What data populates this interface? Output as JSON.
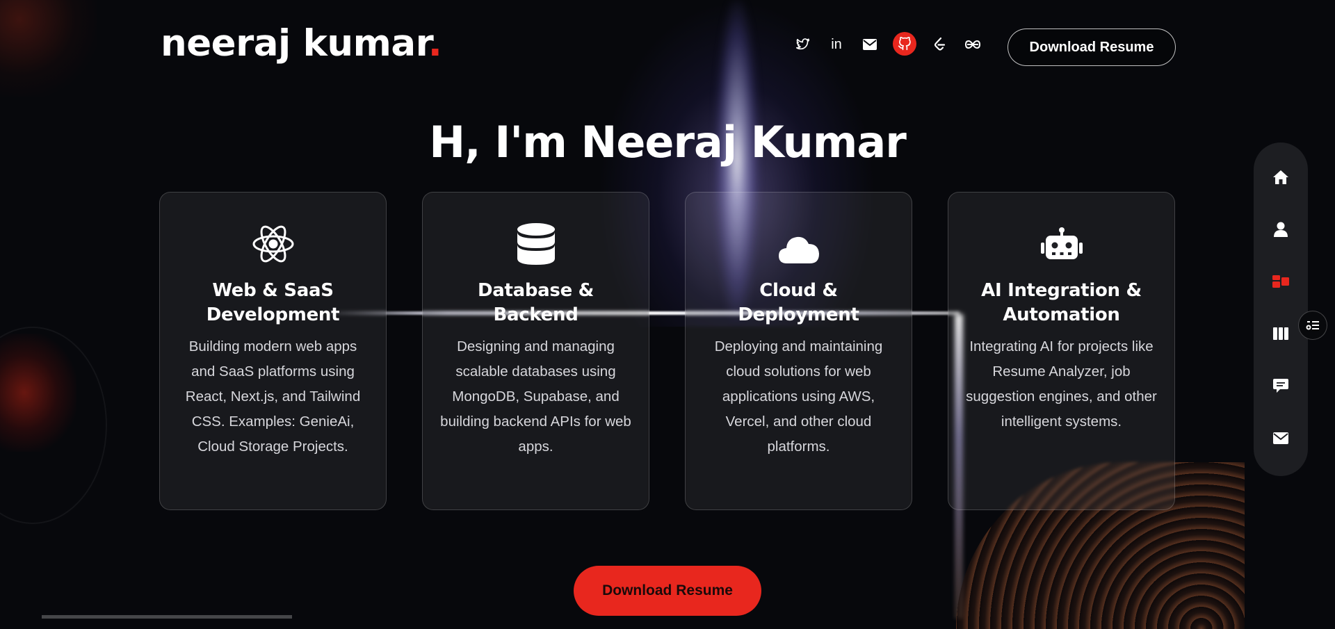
{
  "header": {
    "logo_text": "neeraj kumar",
    "logo_dot": ".",
    "download_label": "Download Resume",
    "socials": [
      {
        "name": "twitter-icon",
        "glyph": "🐦"
      },
      {
        "name": "linkedin-icon",
        "glyph": "in"
      },
      {
        "name": "mail-icon",
        "glyph": "✉"
      },
      {
        "name": "github-icon",
        "glyph": ""
      },
      {
        "name": "leetcode-icon",
        "glyph": ""
      },
      {
        "name": "link-icon",
        "glyph": ""
      }
    ]
  },
  "hero": {
    "title": "H, I'm Neeraj Kumar"
  },
  "cards": [
    {
      "icon": "react-icon",
      "title_line1": "Web & SaaS",
      "title_line2": "Development",
      "desc": "Building modern web apps and SaaS platforms using React, Next.js, and Tailwind CSS. Examples: GenieAi, Cloud Storage Projects."
    },
    {
      "icon": "database-icon",
      "title_line1": "Database &",
      "title_line2": "Backend",
      "desc": "Designing and managing scalable databases using MongoDB, Supabase, and building backend APIs for web apps."
    },
    {
      "icon": "cloud-icon",
      "title_line1": "Cloud &",
      "title_line2": "Deployment",
      "desc": "Deploying and maintaining cloud solutions for web applications using AWS, Vercel, and other cloud platforms."
    },
    {
      "icon": "robot-icon",
      "title_line1": "AI Integration &",
      "title_line2": "Automation",
      "desc": "Integrating AI for projects like Resume Analyzer, job suggestion engines, and other intelligent systems."
    }
  ],
  "cta": {
    "label": "Download Resume"
  },
  "side_nav": {
    "items": [
      "home-icon",
      "user-icon",
      "services-icon",
      "portfolio-icon",
      "chat-icon",
      "mail-icon"
    ],
    "active": "services-icon",
    "active_color": "#e8271e"
  },
  "colors": {
    "accent": "#e8271e",
    "background": "#07080c"
  }
}
